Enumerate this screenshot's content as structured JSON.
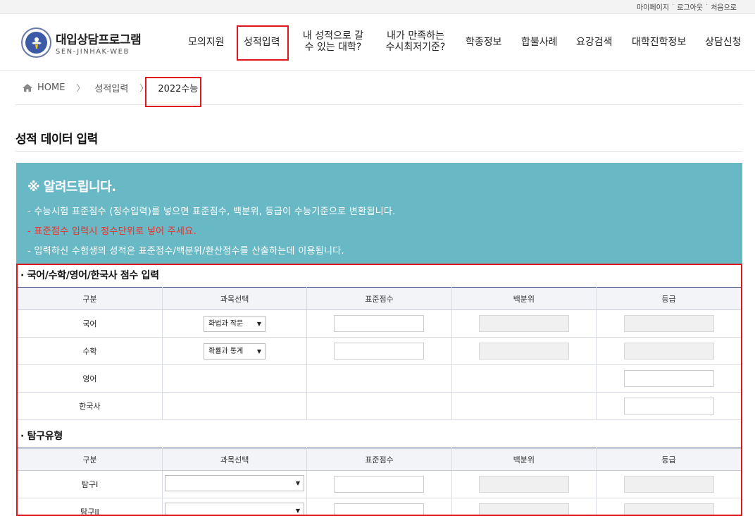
{
  "toplinks": [
    "마이페이지",
    "로그아웃",
    "처음으로"
  ],
  "logo": {
    "title": "대입상담프로그램",
    "subtitle": "SEN-JINHAK-WEB"
  },
  "nav": [
    "모의지원",
    "성적입력",
    "내 성적으로 갈",
    "수 있는 대학?",
    "내가 만족하는",
    "수시최저기준?",
    "학종정보",
    "합불사례",
    "요강검색",
    "대학진학정보",
    "상담신청"
  ],
  "breadcrumb": {
    "home": "HOME",
    "level1": "성적입력",
    "current": "2022수능",
    "sep": "〉"
  },
  "page_title": "성적 데이터 입력",
  "notice": {
    "title": "※ 알려드립니다.",
    "lines": [
      "- 수능시험 표준점수 (정수입력)를 넣으면 표준점수, 백분위, 등급이 수능기준으로 변환됩니다.",
      "- 표준점수 입력시 정수단위로 넣어 주세요.",
      "- 입력하신 수험생의 성적은 표준점수/백분위/환산점수를 산출하는데 이용됩니다."
    ]
  },
  "section1": {
    "title": "· 국어/수학/영어/한국사 점수 입력",
    "headers": [
      "구분",
      "과목선택",
      "표준점수",
      "백분위",
      "등급"
    ],
    "rows": [
      "국어",
      "수학",
      "영어",
      "한국사"
    ],
    "selects": [
      "화법과 작문",
      "확률과 통계"
    ]
  },
  "section2": {
    "title": "· 탐구유형",
    "headers": [
      "구분",
      "과목선택",
      "표준점수",
      "백분위",
      "등급"
    ],
    "rows": [
      "탐구I",
      "탐구II"
    ]
  },
  "colors": {
    "notice_bg": "#69b8c5",
    "highlight": "#e0141b",
    "warn_text": "#e8322a",
    "table_header_bg": "#f3f4f7"
  }
}
